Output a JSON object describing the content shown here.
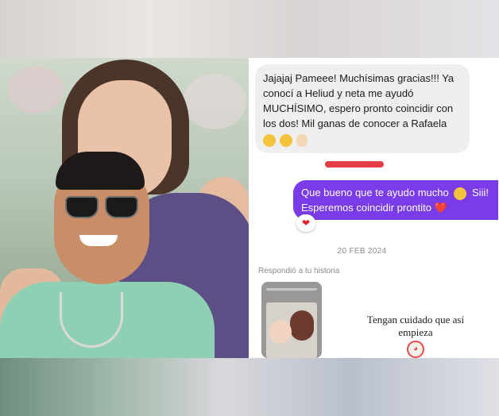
{
  "chat": {
    "incoming_message": "Jajajaj Pameee! Muchísimas gracias!!! Ya conocí a Heliud y neta me ayudó MUCHÍSIMO, espero pronto coincidir con los dos! Mil ganas de conocer a Rafaela",
    "incoming_emojis": [
      "smile-emoji",
      "smile-emoji",
      "praying-hands-emoji"
    ],
    "outgoing_message": "Que bueno que te ayudo mucho",
    "outgoing_message_2": "Siii! Esperemos coincidir prontito",
    "reaction": "❤",
    "heart": "❤️",
    "date": "20 FEB 2024",
    "story_reply_label": "Respondió a tu historia",
    "story_caption": "Tengan cuidado que así empieza",
    "clown_emoji": "clown-emoji"
  },
  "colors": {
    "outgoing_bubble": "#7a3be8",
    "incoming_bubble": "#efeff1",
    "redaction": "#e63d46"
  }
}
